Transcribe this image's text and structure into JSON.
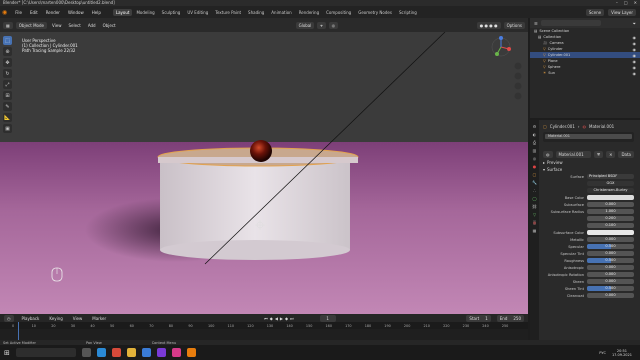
{
  "window": {
    "title": "Blender* [C:\\Users\\marten000\\Desktop\\untitled2.blend]"
  },
  "menus": [
    "File",
    "Edit",
    "Render",
    "Window",
    "Help"
  ],
  "workspaces": [
    {
      "label": "Layout",
      "active": true
    },
    {
      "label": "Modeling"
    },
    {
      "label": "Sculpting"
    },
    {
      "label": "UV Editing"
    },
    {
      "label": "Texture Paint"
    },
    {
      "label": "Shading"
    },
    {
      "label": "Animation"
    },
    {
      "label": "Rendering"
    },
    {
      "label": "Compositing"
    },
    {
      "label": "Geometry Nodes"
    },
    {
      "label": "Scripting"
    }
  ],
  "top_right": {
    "scene": "Scene",
    "view_layer": "View Layer"
  },
  "viewport_header": {
    "mode": "Object Mode",
    "view": "View",
    "select": "Select",
    "add": "Add",
    "object": "Object",
    "transform": "Global",
    "options": "Options"
  },
  "viewport_info": [
    "User Perspective",
    "(1) Collection | Cylinder.001",
    "Path Tracing Sample 22/32"
  ],
  "outliner": {
    "title": "Scene Collection",
    "items": [
      {
        "label": "Collection",
        "selected": false
      },
      {
        "label": "Camera",
        "selected": false
      },
      {
        "label": "Cylinder",
        "selected": false
      },
      {
        "label": "Cylinder.001",
        "selected": true
      },
      {
        "label": "Plane",
        "selected": false
      },
      {
        "label": "Sphere",
        "selected": false
      },
      {
        "label": "Sun",
        "selected": false
      }
    ]
  },
  "properties": {
    "object": "Cylinder.001",
    "material_tab": "Material.001",
    "slot": "Material.001",
    "material": "Material.001",
    "data_label": "Data",
    "preview": "Preview",
    "surface_section": "Surface",
    "surface_label": "Surface",
    "surface_value": "Principled BSDF",
    "ggx": "GGX",
    "sss": "Christensen-Burley",
    "rows": [
      {
        "label": "Base Color",
        "type": "color",
        "color": "#dcdcdc"
      },
      {
        "label": "Subsurface",
        "value": "0.000",
        "fill": 0
      },
      {
        "label": "Subsurface Radius",
        "value": "1.000"
      },
      {
        "label": "",
        "value": "0.200"
      },
      {
        "label": "",
        "value": "0.100"
      },
      {
        "label": "Subsurface Color",
        "type": "color",
        "color": "#e8e8e8"
      },
      {
        "label": "Metallic",
        "value": "0.000",
        "fill": 0
      },
      {
        "label": "Specular",
        "value": "0.500",
        "fill": 0.5
      },
      {
        "label": "Specular Tint",
        "value": "0.000",
        "fill": 0
      },
      {
        "label": "Roughness",
        "value": "0.500",
        "fill": 0.5
      },
      {
        "label": "Anisotropic",
        "value": "0.000",
        "fill": 0
      },
      {
        "label": "Anisotropic Rotation",
        "value": "0.000",
        "fill": 0
      },
      {
        "label": "Sheen",
        "value": "0.000",
        "fill": 0
      },
      {
        "label": "Sheen Tint",
        "value": "0.500",
        "fill": 0.5
      },
      {
        "label": "Clearcoat",
        "value": "0.000",
        "fill": 0
      }
    ]
  },
  "timeline": {
    "playback": "Playback",
    "keying": "Keying",
    "view": "View",
    "marker": "Marker",
    "current_frame": "1",
    "start_label": "Start",
    "start": "1",
    "end_label": "End",
    "end": "250",
    "ticks": [
      "0",
      "10",
      "20",
      "30",
      "40",
      "50",
      "60",
      "70",
      "80",
      "90",
      "100",
      "110",
      "120",
      "130",
      "140",
      "150",
      "160",
      "170",
      "180",
      "190",
      "200",
      "210",
      "220",
      "230",
      "240",
      "250"
    ]
  },
  "status": {
    "left": "Set Active Modifier",
    "middle": "Pan View",
    "right": "Context Menu"
  },
  "taskbar": {
    "time": "20:51",
    "date": "17.09.2021",
    "lang": "РУС"
  },
  "colors": {
    "accent": "#4772b3",
    "floor": "#a5679a",
    "header": "#2a2a2a"
  }
}
